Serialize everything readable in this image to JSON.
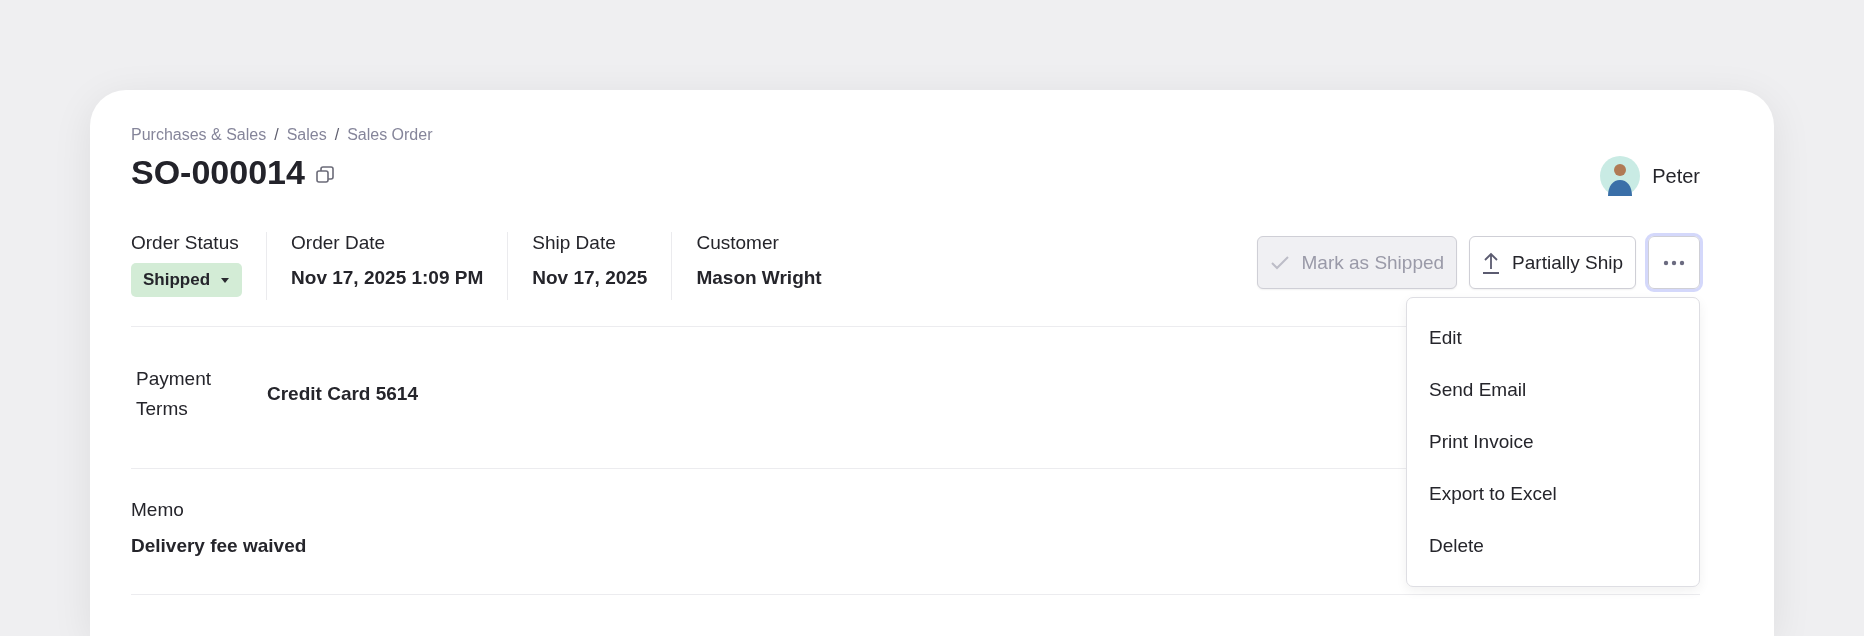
{
  "breadcrumb": [
    {
      "kind": "link",
      "text": "Purchases & Sales"
    },
    {
      "kind": "separator",
      "text": "/"
    },
    {
      "kind": "link",
      "text": "Sales"
    },
    {
      "kind": "separator",
      "text": "/"
    },
    {
      "kind": "link",
      "text": "Sales Order"
    }
  ],
  "title": "SO-000014",
  "user": {
    "name": "Peter"
  },
  "fields": [
    {
      "kind": "status",
      "label": "Order Status",
      "value": "Shipped"
    },
    {
      "kind": "text",
      "label": "Order Date",
      "value": "Nov 17, 2025 1:09 PM"
    },
    {
      "kind": "text",
      "label": "Ship Date",
      "value": "Nov 17, 2025"
    },
    {
      "kind": "text",
      "label": "Customer",
      "value": "Mason Wright"
    }
  ],
  "actions": [
    {
      "kind": "check",
      "label": "Mark as Shipped",
      "disabled": true
    },
    {
      "kind": "upload",
      "label": "Partially Ship",
      "disabled": false
    },
    {
      "kind": "more",
      "disabled": false,
      "open": true
    }
  ],
  "menu": [
    {
      "label": "Edit"
    },
    {
      "label": "Send Email"
    },
    {
      "label": "Print Invoice"
    },
    {
      "label": "Export to Excel"
    },
    {
      "label": "Delete"
    }
  ],
  "details": [
    {
      "kind": "inline",
      "label": "Payment Terms",
      "value": "Credit Card 5614"
    },
    {
      "kind": "stacked",
      "label": "Memo",
      "value": "Delivery fee waived"
    }
  ]
}
